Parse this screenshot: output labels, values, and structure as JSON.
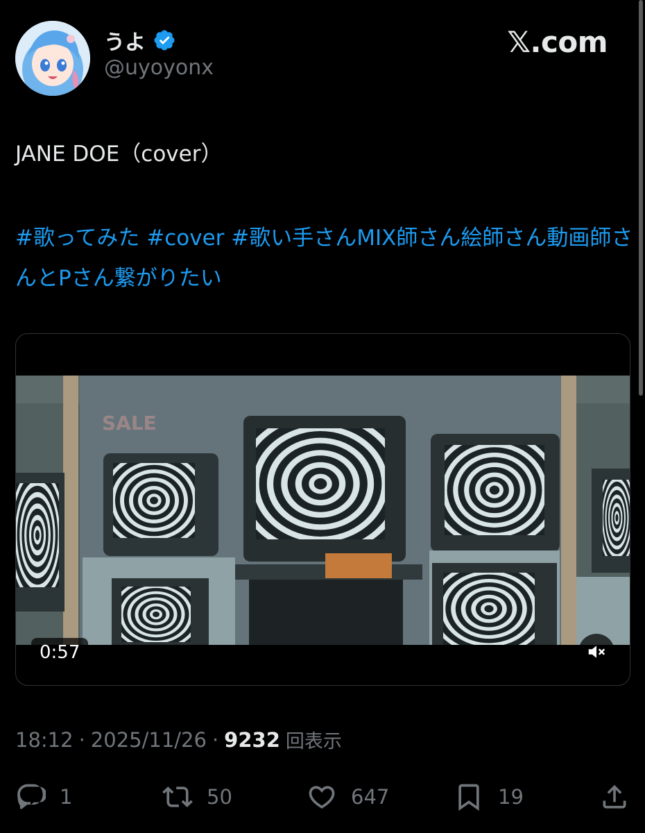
{
  "author": {
    "display_name": "うよ",
    "handle": "@uyoyonx",
    "verified": true,
    "avatar_icon": "avatar-image"
  },
  "brand": "𝕏.com",
  "tweet": {
    "text": "JANE DOE（cover）",
    "hashtags_line": "#歌ってみた #cover  #歌い手さんMIX師さん絵師さん動画師さんとPさん繋がりたい"
  },
  "media": {
    "duration": "0:57",
    "mute_icon": "speaker-muted-icon",
    "sale_sign": "SALE"
  },
  "meta": {
    "time": "18:12",
    "separator1": "·",
    "date": "2025/11/26",
    "separator2": "·",
    "views": "9232",
    "views_label": "回表示"
  },
  "actions": {
    "replies": "1",
    "reposts": "50",
    "likes": "647",
    "bookmarks": "19"
  },
  "colors": {
    "background": "#000000",
    "text": "#e7e9ea",
    "secondary": "#71767b",
    "link": "#1d9bf0",
    "verified": "#1d9bf0"
  }
}
